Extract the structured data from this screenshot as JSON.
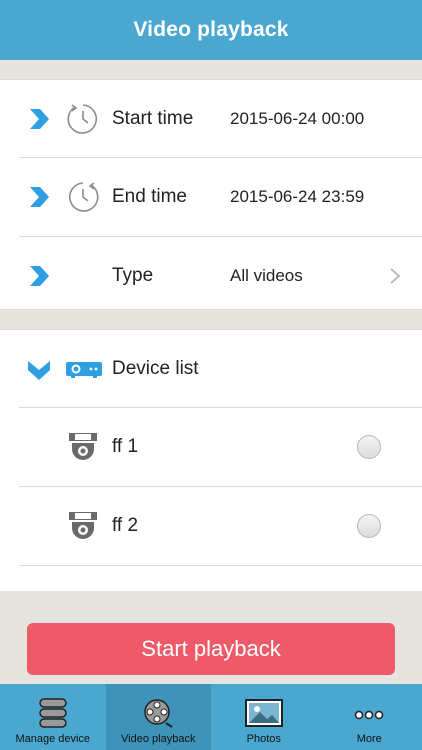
{
  "header": {
    "title": "Video playback"
  },
  "time_section": {
    "start": {
      "label": "Start time",
      "value": "2015-06-24 00:00"
    },
    "end": {
      "label": "End time",
      "value": "2015-06-24 23:59"
    },
    "type": {
      "label": "Type",
      "value": "All videos"
    }
  },
  "device_section": {
    "title": "Device list",
    "devices": [
      {
        "name": "ff 1",
        "selected": false
      },
      {
        "name": "ff 2",
        "selected": false
      }
    ]
  },
  "action": {
    "start_label": "Start playback"
  },
  "tabbar": {
    "active_index": 1,
    "tabs": [
      {
        "label": "Manage device",
        "icon": "database-icon"
      },
      {
        "label": "Video playback",
        "icon": "film-reel-icon"
      },
      {
        "label": "Photos",
        "icon": "picture-icon"
      },
      {
        "label": "More",
        "icon": "more-dots-icon"
      }
    ]
  },
  "colors": {
    "primary": "#4aa8d0",
    "accent_blue": "#2e9fe0",
    "button_red": "#ef5a68",
    "background": "#e6e4df"
  }
}
